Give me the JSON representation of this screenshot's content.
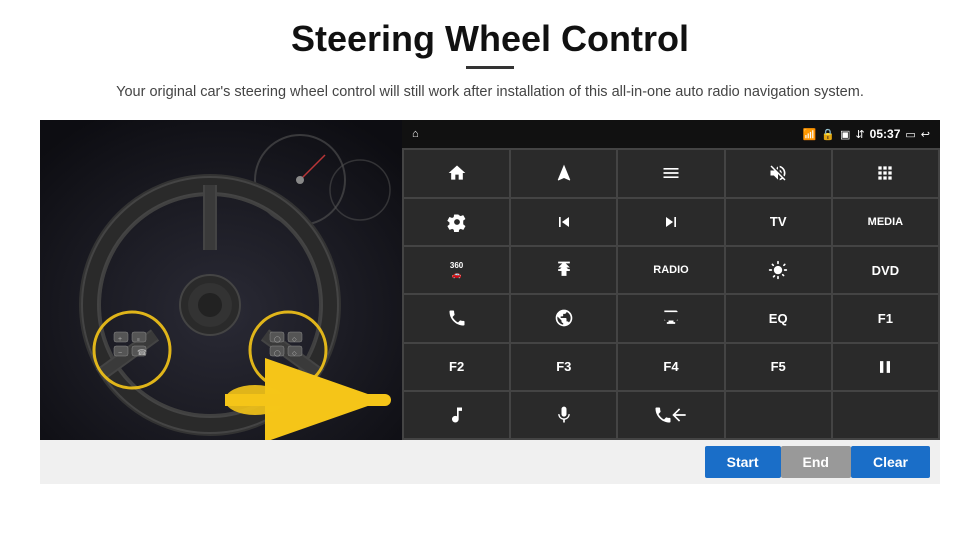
{
  "page": {
    "title": "Steering Wheel Control",
    "subtitle": "Your original car's steering wheel control will still work after installation of this all-in-one auto radio navigation system.",
    "divider": true
  },
  "status_bar": {
    "time": "05:37",
    "icons": [
      "wifi",
      "lock",
      "sd-card",
      "bluetooth",
      "screen"
    ]
  },
  "button_grid": [
    [
      {
        "label": "",
        "icon": "home",
        "row": 1,
        "col": 1
      },
      {
        "label": "",
        "icon": "navigate",
        "row": 1,
        "col": 2
      },
      {
        "label": "",
        "icon": "menu-list",
        "row": 1,
        "col": 3
      },
      {
        "label": "",
        "icon": "mute",
        "row": 1,
        "col": 4
      },
      {
        "label": "",
        "icon": "apps",
        "row": 1,
        "col": 5
      }
    ],
    [
      {
        "label": "",
        "icon": "settings-circle",
        "row": 2,
        "col": 1
      },
      {
        "label": "",
        "icon": "prev",
        "row": 2,
        "col": 2
      },
      {
        "label": "",
        "icon": "next",
        "row": 2,
        "col": 3
      },
      {
        "label": "TV",
        "icon": "",
        "row": 2,
        "col": 4
      },
      {
        "label": "MEDIA",
        "icon": "",
        "row": 2,
        "col": 5
      }
    ],
    [
      {
        "label": "",
        "icon": "360cam",
        "row": 3,
        "col": 1
      },
      {
        "label": "",
        "icon": "eject",
        "row": 3,
        "col": 2
      },
      {
        "label": "RADIO",
        "icon": "",
        "row": 3,
        "col": 3
      },
      {
        "label": "",
        "icon": "brightness",
        "row": 3,
        "col": 4
      },
      {
        "label": "DVD",
        "icon": "",
        "row": 3,
        "col": 5
      }
    ],
    [
      {
        "label": "",
        "icon": "phone",
        "row": 4,
        "col": 1
      },
      {
        "label": "",
        "icon": "swirl",
        "row": 4,
        "col": 2
      },
      {
        "label": "",
        "icon": "screen-share",
        "row": 4,
        "col": 3
      },
      {
        "label": "EQ",
        "icon": "",
        "row": 4,
        "col": 4
      },
      {
        "label": "F1",
        "icon": "",
        "row": 4,
        "col": 5
      }
    ],
    [
      {
        "label": "F2",
        "icon": "",
        "row": 5,
        "col": 1
      },
      {
        "label": "F3",
        "icon": "",
        "row": 5,
        "col": 2
      },
      {
        "label": "F4",
        "icon": "",
        "row": 5,
        "col": 3
      },
      {
        "label": "F5",
        "icon": "",
        "row": 5,
        "col": 4
      },
      {
        "label": "",
        "icon": "play-pause",
        "row": 5,
        "col": 5
      }
    ],
    [
      {
        "label": "",
        "icon": "music",
        "row": 6,
        "col": 1
      },
      {
        "label": "",
        "icon": "mic",
        "row": 6,
        "col": 2
      },
      {
        "label": "",
        "icon": "phone-answer",
        "row": 6,
        "col": 3
      },
      {
        "label": "",
        "icon": "",
        "row": 6,
        "col": 4
      },
      {
        "label": "",
        "icon": "",
        "row": 6,
        "col": 5
      }
    ]
  ],
  "bottom_buttons": {
    "start_label": "Start",
    "end_label": "End",
    "clear_label": "Clear"
  }
}
